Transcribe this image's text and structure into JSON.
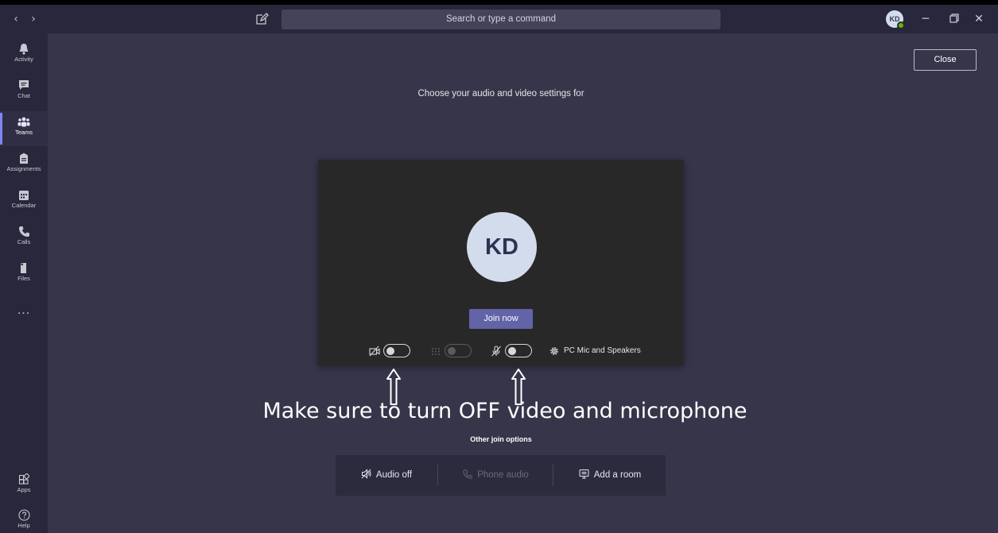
{
  "search": {
    "placeholder": "Search or type a command"
  },
  "profile": {
    "initials": "KD"
  },
  "rail": {
    "items": [
      {
        "label": "Activity",
        "icon": "bell-icon"
      },
      {
        "label": "Chat",
        "icon": "chat-icon"
      },
      {
        "label": "Teams",
        "icon": "teams-icon",
        "active": true
      },
      {
        "label": "Assignments",
        "icon": "assignments-icon"
      },
      {
        "label": "Calendar",
        "icon": "calendar-icon"
      },
      {
        "label": "Calls",
        "icon": "phone-icon"
      },
      {
        "label": "Files",
        "icon": "file-icon"
      }
    ],
    "more": "...",
    "apps_label": "Apps",
    "help_label": "Help"
  },
  "main": {
    "close_label": "Close",
    "heading": "Choose your audio and video settings for",
    "avatar_initials": "KD",
    "join_label": "Join now",
    "device_label": "PC Mic and Speakers",
    "instruction": "Make sure to turn OFF video and microphone",
    "other_options_label": "Other join options",
    "options": {
      "audio_off": "Audio off",
      "phone_audio": "Phone audio",
      "add_room": "Add a room"
    }
  },
  "colors": {
    "accent": "#6264a7",
    "background": "#36354a",
    "rail": "#28273b",
    "preview": "#292828",
    "presence": "#6bb700"
  }
}
